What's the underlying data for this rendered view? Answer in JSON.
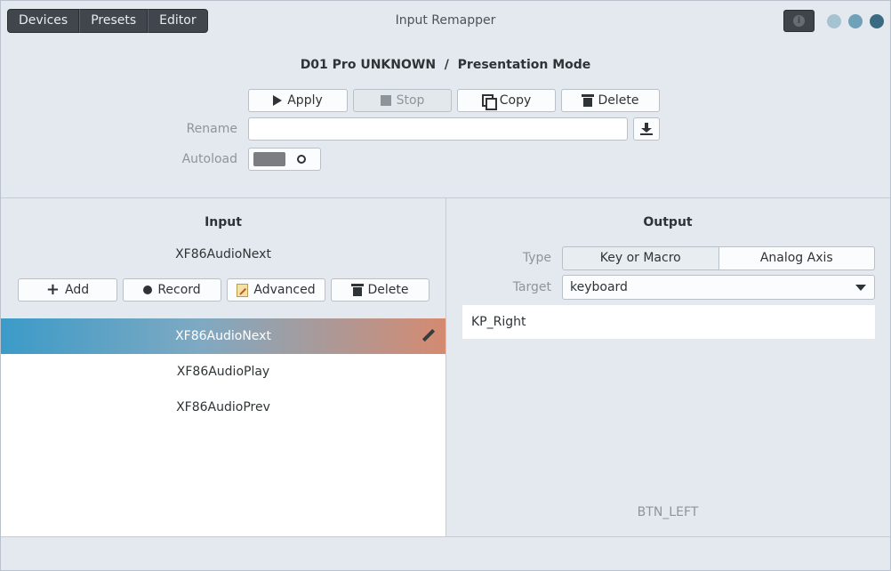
{
  "header": {
    "tabs": [
      "Devices",
      "Presets",
      "Editor"
    ],
    "title": "Input Remapper",
    "info_icon": "info-icon",
    "window_controls": [
      "minimize",
      "maximize",
      "close"
    ]
  },
  "preset": {
    "device": "D01 Pro UNKNOWN",
    "separator": "/",
    "name": "Presentation Mode",
    "buttons": {
      "apply": "Apply",
      "stop": "Stop",
      "copy": "Copy",
      "delete": "Delete"
    },
    "rename_label": "Rename",
    "rename_value": "",
    "autoload_label": "Autoload",
    "autoload_on": false
  },
  "input": {
    "title": "Input",
    "selected": "XF86AudioNext",
    "buttons": {
      "add": "Add",
      "record": "Record",
      "advanced": "Advanced",
      "delete": "Delete"
    },
    "items": [
      "XF86AudioNext",
      "XF86AudioPlay",
      "XF86AudioPrev"
    ]
  },
  "output": {
    "title": "Output",
    "type_label": "Type",
    "type_options": [
      "Key or Macro",
      "Analog Axis"
    ],
    "type_selected": "Key or Macro",
    "target_label": "Target",
    "target_value": "keyboard",
    "output_value": "KP_Right",
    "hint": "BTN_LEFT"
  },
  "colors": {
    "accent_gradient_start": "#3b9bc8",
    "accent_gradient_end": "#d58a70",
    "window_control_close": "#3b6b82"
  }
}
